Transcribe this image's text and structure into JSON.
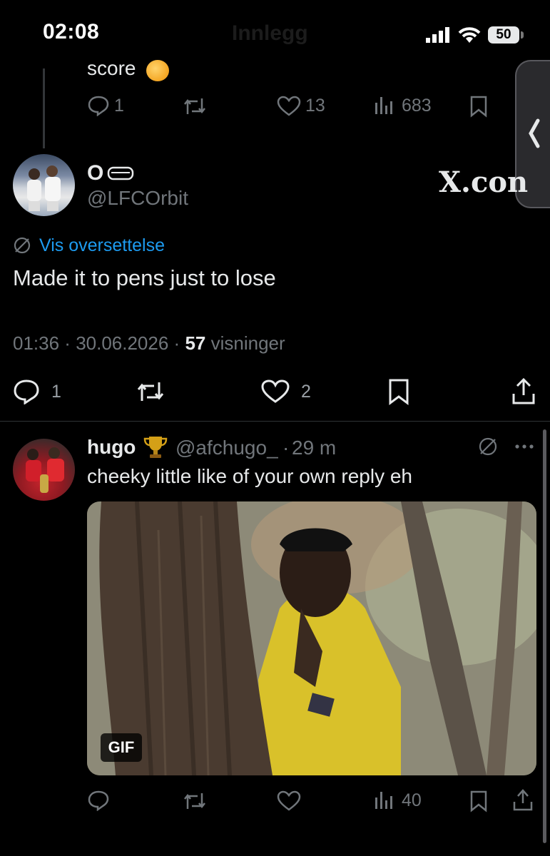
{
  "status_bar": {
    "time": "02:08",
    "ghost_title": "Innlegg",
    "battery": "50"
  },
  "prev_post": {
    "text": "score",
    "replies": "1",
    "likes": "13",
    "views": "683"
  },
  "main_post": {
    "name": "O",
    "handle": "@LFCOrbit",
    "translate_label": "Vis oversettelse",
    "text": "Made it to pens just to lose",
    "time": "01:36",
    "date": "30.06.2026",
    "views_count": "57",
    "views_label": "visninger",
    "replies": "1",
    "likes": "2"
  },
  "reply": {
    "name": "hugo",
    "handle": "@afchugo_",
    "age": "29 m",
    "text": "cheeky little like of your own reply eh",
    "gif_label": "GIF",
    "views": "40"
  },
  "brand": {
    "x_text": "X.con"
  },
  "colors": {
    "background": "#000000",
    "text": "#e7e9ea",
    "muted": "#71767b",
    "link": "#1d9bf0"
  }
}
